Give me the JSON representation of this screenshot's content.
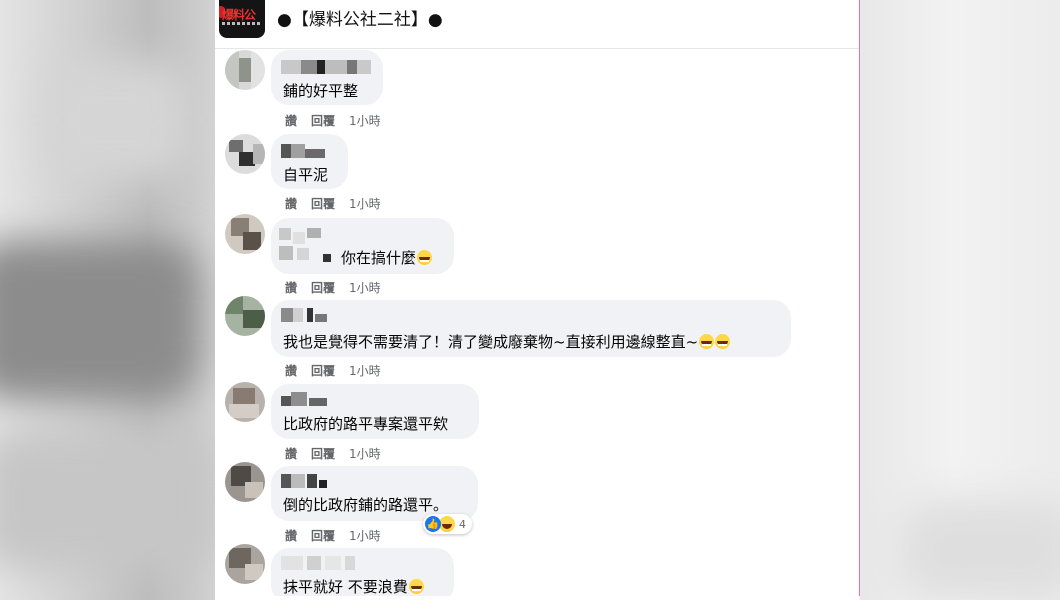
{
  "header": {
    "logo_text": "爆料公",
    "title": "●【爆料公社二社】●"
  },
  "actions": {
    "like": "讚",
    "reply": "回覆"
  },
  "comments": [
    {
      "text": "鋪的好平整",
      "time": "1小時"
    },
    {
      "text": "自平泥",
      "time": "1小時"
    },
    {
      "text": "你在搞什麼",
      "time": "1小時",
      "emoji": "grinning-squinting-face"
    },
    {
      "text": "我也是覺得不需要清了！清了變成廢棄物~直接利用邊線整直~",
      "time": "1小時",
      "emoji": "grinning-squinting-face x2"
    },
    {
      "text": "比政府的路平專案還平欸",
      "time": "1小時"
    },
    {
      "text": "倒的比政府鋪的路還平。",
      "time": "1小時",
      "reactions": {
        "icons": [
          "like-icon",
          "haha-icon"
        ],
        "count": "4"
      }
    },
    {
      "text": "抹平就好 不要浪費",
      "time": "",
      "emoji": "grinning-squinting-face"
    }
  ],
  "colors": {
    "bubble": "#f0f2f5",
    "meta": "#65676b",
    "like_blue": "#1877f2",
    "panel_border": "#e36bd4"
  }
}
